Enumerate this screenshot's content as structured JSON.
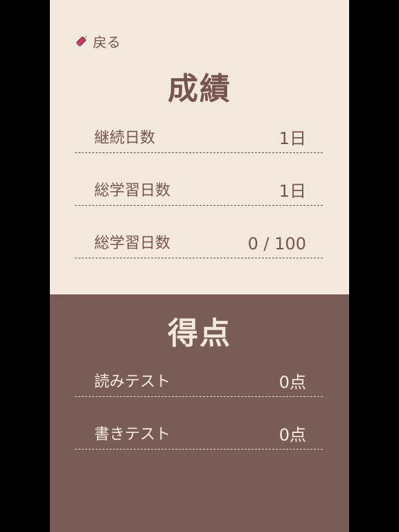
{
  "header": {
    "back_label": "戻る",
    "back_icon": "pencil-icon"
  },
  "records": {
    "title": "成績",
    "rows": [
      {
        "label": "継続日数",
        "value": "1日"
      },
      {
        "label": "総学習日数",
        "value": "1日"
      },
      {
        "label": "総学習日数",
        "value": "0 / 100"
      }
    ]
  },
  "scores": {
    "title": "得点",
    "rows": [
      {
        "label": "読みテスト",
        "value": "0点"
      },
      {
        "label": "書きテスト",
        "value": "0点"
      }
    ]
  },
  "colors": {
    "cream_bg": "#f2e9dc",
    "brown_bg": "#7a5c56",
    "text_brown": "#76544f",
    "text_light": "#f6ece2"
  }
}
